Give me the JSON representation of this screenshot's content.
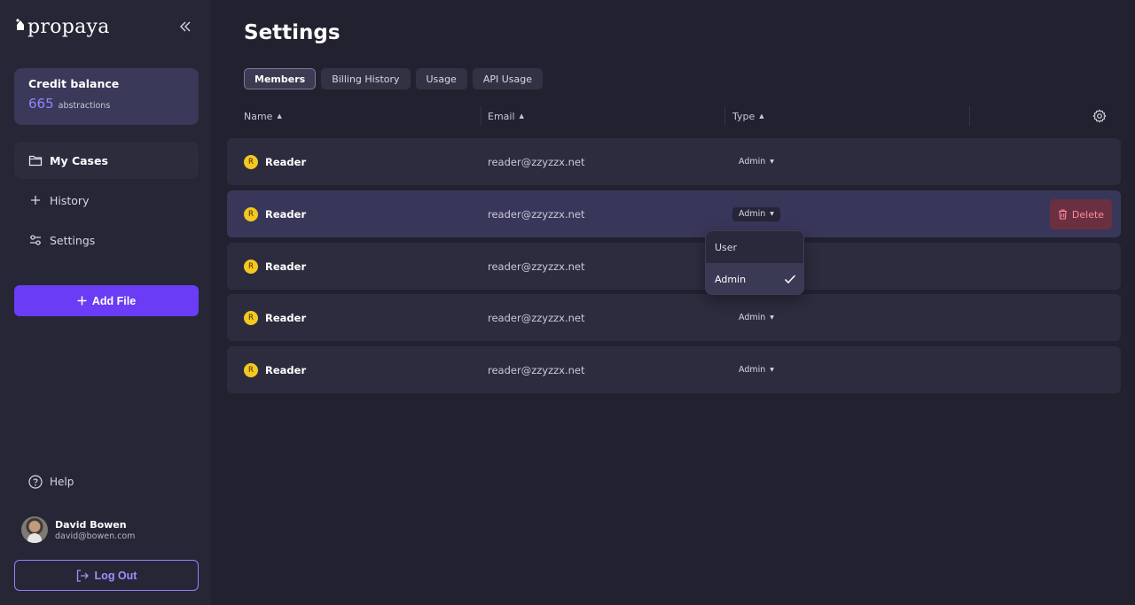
{
  "app": {
    "logo_text": "propaya"
  },
  "sidebar": {
    "credit": {
      "title": "Credit balance",
      "value": "665",
      "unit": "abstractions"
    },
    "nav": [
      {
        "label": "My Cases",
        "icon": "folder-icon",
        "active": true
      },
      {
        "label": "History",
        "icon": "plus-icon",
        "active": false
      },
      {
        "label": "Settings",
        "icon": "sliders-icon",
        "active": false
      }
    ],
    "add_file_label": "Add File",
    "help_label": "Help",
    "user": {
      "name": "David Bowen",
      "email": "david@bowen.com"
    },
    "logout_label": "Log Out"
  },
  "main": {
    "title": "Settings",
    "tabs": [
      {
        "label": "Members",
        "active": true
      },
      {
        "label": "Billing History",
        "active": false
      },
      {
        "label": "Usage",
        "active": false
      },
      {
        "label": "API Usage",
        "active": false
      }
    ],
    "columns": {
      "name": "Name",
      "email": "Email",
      "type": "Type"
    },
    "rows": [
      {
        "initial": "R",
        "name": "Reader",
        "email": "reader@zzyzzx.net",
        "type": "Admin"
      },
      {
        "initial": "R",
        "name": "Reader",
        "email": "reader@zzyzzx.net",
        "type": "Admin"
      },
      {
        "initial": "R",
        "name": "Reader",
        "email": "reader@zzyzzx.net",
        "type": "Admin"
      },
      {
        "initial": "R",
        "name": "Reader",
        "email": "reader@zzyzzx.net",
        "type": "Admin"
      },
      {
        "initial": "R",
        "name": "Reader",
        "email": "reader@zzyzzx.net",
        "type": "Admin"
      }
    ],
    "delete_label": "Delete",
    "type_dropdown": {
      "options": [
        {
          "label": "User",
          "selected": false
        },
        {
          "label": "Admin",
          "selected": true
        }
      ]
    }
  },
  "colors": {
    "accent": "#6a3cf5",
    "accent_text": "#8f86ff",
    "badge": "#f4c821",
    "danger_text": "#ff8a9c",
    "background": "#22212f"
  }
}
